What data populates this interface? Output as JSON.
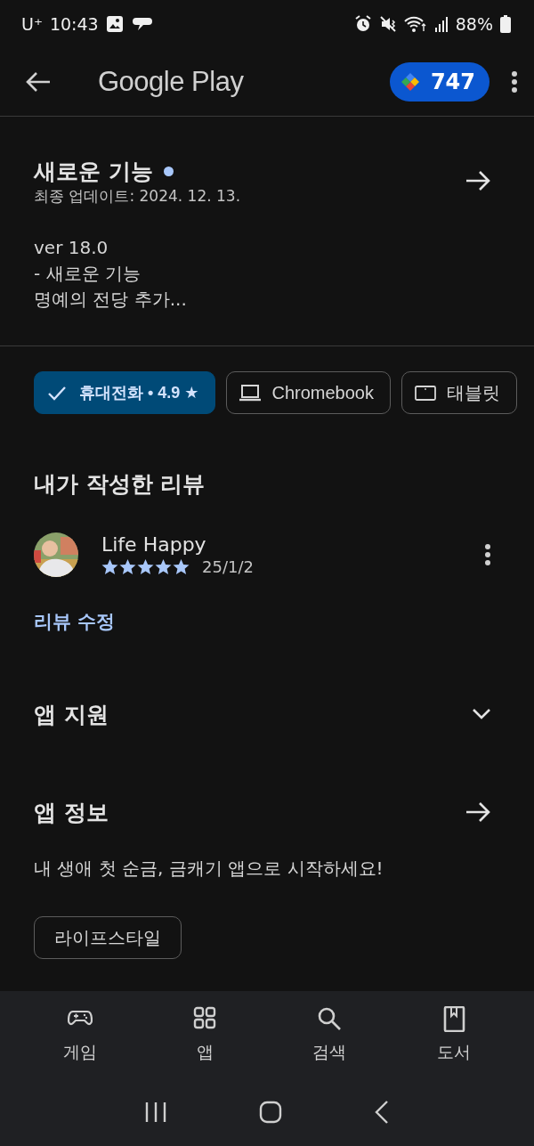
{
  "status_bar": {
    "carrier": "U⁺",
    "time": "10:43",
    "battery": "88%"
  },
  "app_bar": {
    "title": "Google Play",
    "points": "747"
  },
  "whats_new": {
    "title": "새로운 기능",
    "unread": true,
    "updated": "최종 업데이트: 2024. 12. 13.",
    "notes": [
      "ver 18.0",
      "- 새로운 기능",
      "명예의 전당 추가..."
    ]
  },
  "device_chips": [
    {
      "label": "휴대전화 • 4.9 ★",
      "selected": true
    },
    {
      "kind": "laptop",
      "label": "Chromebook",
      "selected": false
    },
    {
      "kind": "tablet",
      "label": "태블릿",
      "selected": false
    }
  ],
  "my_review": {
    "heading": "내가 작성한 리뷰",
    "author": "Life Happy",
    "stars": 5,
    "date": "25/1/2",
    "edit_link": "리뷰 수정"
  },
  "app_support": {
    "title": "앱 지원",
    "expanded": false
  },
  "app_info": {
    "title": "앱 정보",
    "description": "내 생애 첫 순금, 금캐기 앱으로 시작하세요!",
    "tags": [
      "라이프스타일"
    ]
  },
  "bottom_nav": [
    {
      "kind": "games",
      "label": "게임",
      "selected": false
    },
    {
      "kind": "apps",
      "label": "앱",
      "selected": false
    },
    {
      "kind": "search",
      "label": "검색",
      "selected": false
    },
    {
      "kind": "books",
      "label": "도서",
      "selected": false
    }
  ]
}
